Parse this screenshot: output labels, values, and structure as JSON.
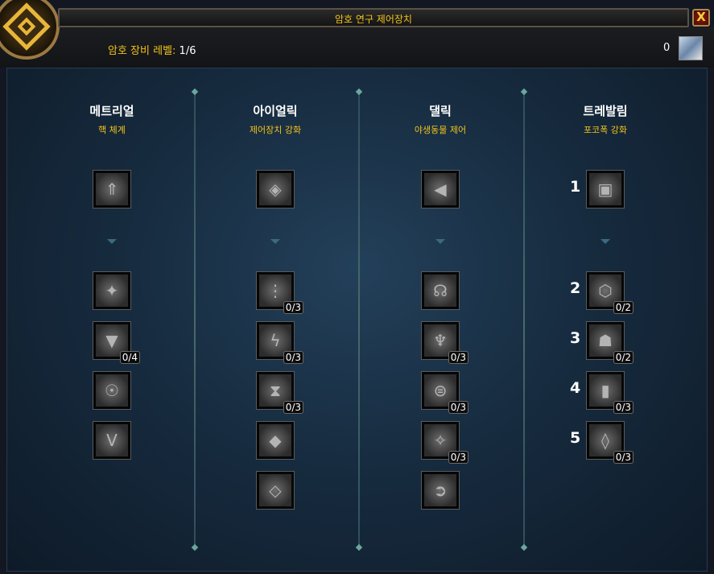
{
  "window": {
    "title": "암호 연구 제어장치",
    "close_label": "X"
  },
  "header": {
    "level_label": "암호 장비 레벨:",
    "level_value": "1/6",
    "currency_amount": "0",
    "currency_icon": "cypher-crystal-icon"
  },
  "columns": [
    {
      "name": "메트리얼",
      "subtitle": "핵 체계",
      "top": {
        "glyph": "⇑",
        "rank": ""
      },
      "nodes": [
        {
          "glyph": "✦",
          "rank": ""
        },
        {
          "glyph": "▼",
          "rank": "0/4"
        },
        {
          "glyph": "☉",
          "rank": ""
        },
        {
          "glyph": "V",
          "rank": ""
        }
      ]
    },
    {
      "name": "아이얼릭",
      "subtitle": "제어장치 강화",
      "top": {
        "glyph": "◈",
        "rank": ""
      },
      "nodes": [
        {
          "glyph": "⋮",
          "rank": "0/3"
        },
        {
          "glyph": "ϟ",
          "rank": "0/3"
        },
        {
          "glyph": "⧗",
          "rank": "0/3"
        },
        {
          "glyph": "◆",
          "rank": ""
        },
        {
          "glyph": "◇",
          "rank": ""
        }
      ]
    },
    {
      "name": "댈릭",
      "subtitle": "야생동물 제어",
      "top": {
        "glyph": "◀",
        "rank": ""
      },
      "nodes": [
        {
          "glyph": "☊",
          "rank": ""
        },
        {
          "glyph": "♆",
          "rank": "0/3"
        },
        {
          "glyph": "⊜",
          "rank": "0/3"
        },
        {
          "glyph": "✧",
          "rank": "0/3"
        },
        {
          "glyph": "➲",
          "rank": ""
        }
      ]
    },
    {
      "name": "트레발림",
      "subtitle": "포코폭 강화",
      "top": {
        "glyph": "▣",
        "rank": "",
        "callout": "1"
      },
      "nodes": [
        {
          "glyph": "⬡",
          "rank": "0/2",
          "callout": "2"
        },
        {
          "glyph": "☗",
          "rank": "0/2",
          "callout": "3"
        },
        {
          "glyph": "▮",
          "rank": "0/3",
          "callout": "4"
        },
        {
          "glyph": "◊",
          "rank": "0/3",
          "callout": "5"
        }
      ]
    }
  ]
}
